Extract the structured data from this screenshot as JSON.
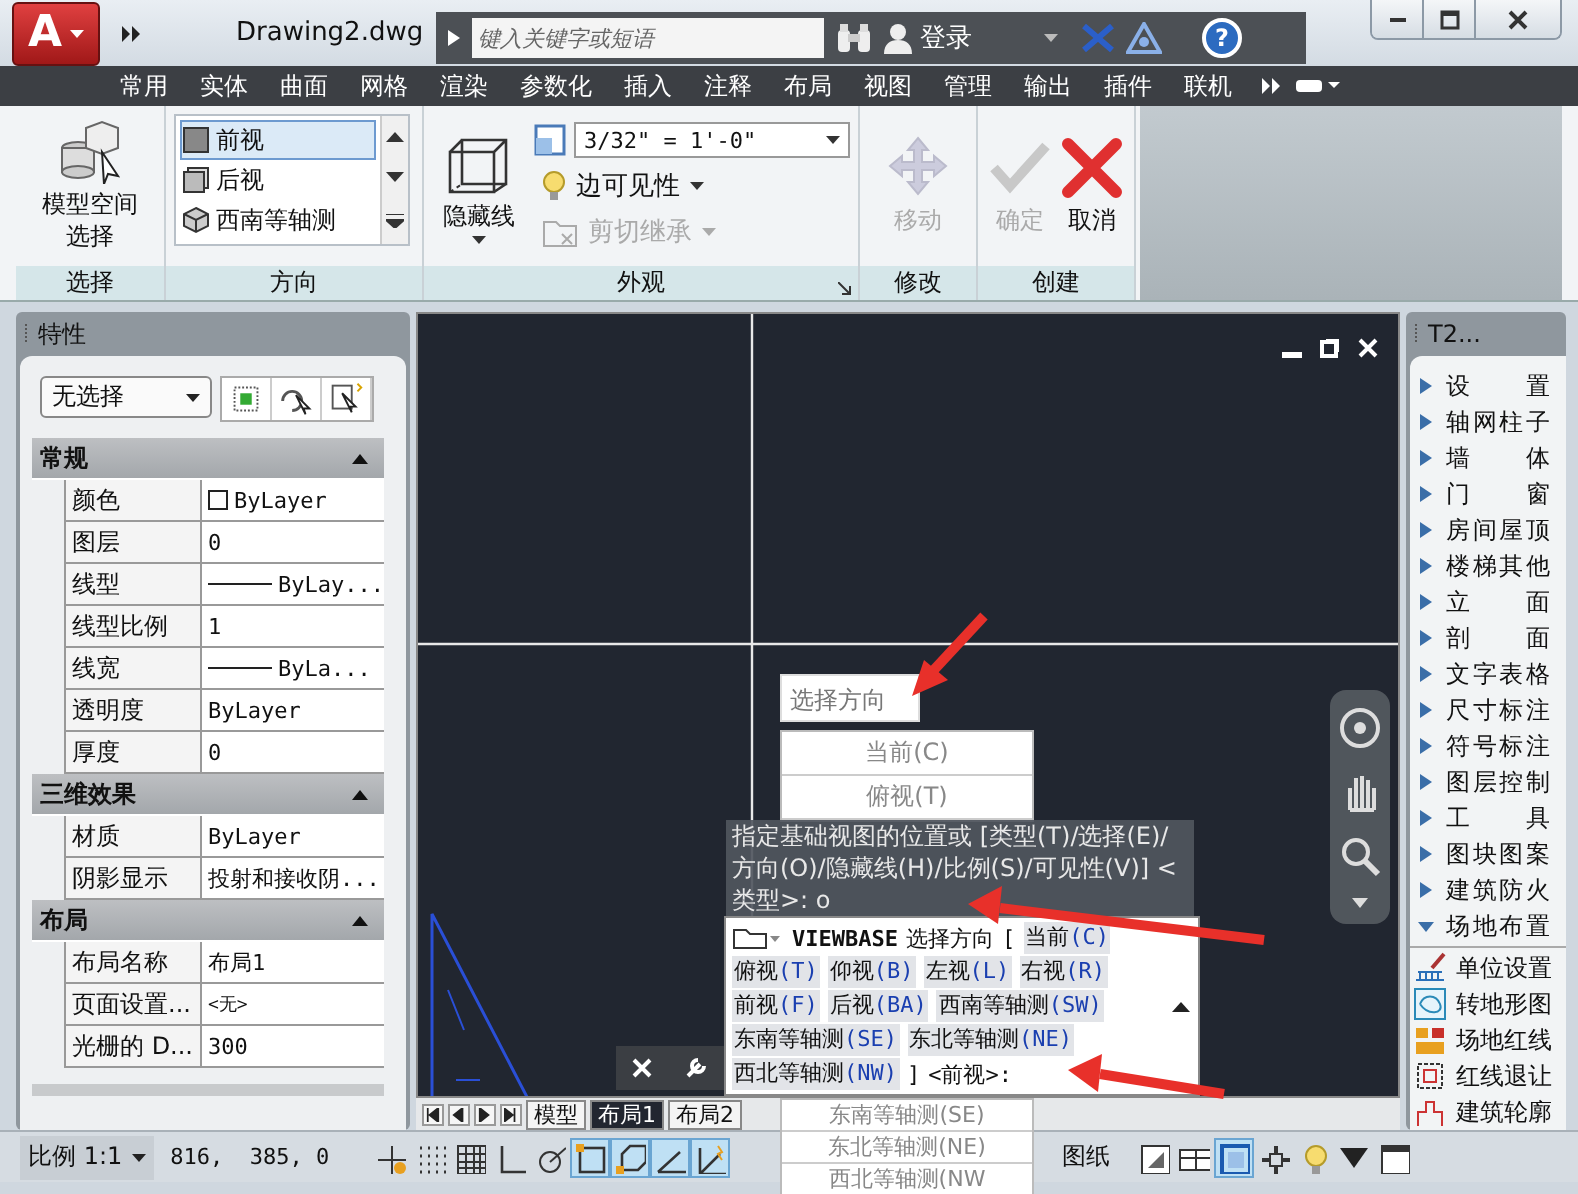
{
  "app": {
    "logo": "A",
    "title": "Drawing2.dwg",
    "search_placeholder": "键入关键字或短语",
    "login": "登录",
    "help": "?"
  },
  "ribbon_tabs": [
    "常用",
    "实体",
    "曲面",
    "网格",
    "渲染",
    "参数化",
    "插入",
    "注释",
    "布局",
    "视图",
    "管理",
    "输出",
    "插件",
    "联机"
  ],
  "ribbon_panels": [
    {
      "kind": "buttons",
      "title": "选择",
      "buttons": [
        {
          "kind": "model-space",
          "label": "模型空间选择",
          "disabled": false
        }
      ]
    },
    {
      "kind": "orientation",
      "title": "方向",
      "items": [
        {
          "label": "前视",
          "selected": true
        },
        {
          "label": "后视",
          "selected": false
        },
        {
          "label": "西南等轴测",
          "selected": false
        }
      ]
    },
    {
      "kind": "appearance",
      "title": "外观",
      "button": "隐藏线",
      "scale": "3/32\" = 1'-0\"",
      "edge_visibility": "边可见性",
      "cut_inheritance": {
        "label": "剪切继承",
        "disabled": true
      }
    },
    {
      "kind": "buttons",
      "title": "修改",
      "buttons": [
        {
          "kind": "move",
          "label": "移动",
          "disabled": true
        }
      ]
    },
    {
      "kind": "buttons",
      "title": "创建",
      "buttons": [
        {
          "kind": "confirm",
          "label": "确定",
          "disabled": true
        },
        {
          "kind": "cancel",
          "label": "取消",
          "disabled": false
        }
      ]
    }
  ],
  "properties": {
    "title": "特性",
    "selection": "无选择",
    "sections": [
      {
        "title": "常规",
        "expanded": true,
        "rows": [
          {
            "name": "颜色",
            "value": "ByLayer",
            "kind": "swatch"
          },
          {
            "name": "图层",
            "value": "0",
            "kind": "text"
          },
          {
            "name": "线型",
            "value": "ByLay...",
            "kind": "line"
          },
          {
            "name": "线型比例",
            "value": "1",
            "kind": "text"
          },
          {
            "name": "线宽",
            "value": "ByLa...",
            "kind": "line"
          },
          {
            "name": "透明度",
            "value": "ByLayer",
            "kind": "text"
          },
          {
            "name": "厚度",
            "value": "0",
            "kind": "text"
          }
        ]
      },
      {
        "title": "三维效果",
        "expanded": true,
        "rows": [
          {
            "name": "材质",
            "value": "ByLayer",
            "kind": "text"
          },
          {
            "name": "阴影显示",
            "value": "投射和接收阴...",
            "kind": "text"
          }
        ]
      },
      {
        "title": "布局",
        "expanded": true,
        "rows": [
          {
            "name": "布局名称",
            "value": "布局1",
            "kind": "text"
          },
          {
            "name": "页面设置...",
            "value": "<无>",
            "kind": "small"
          },
          {
            "name": "光栅的 D...",
            "value": "300",
            "kind": "text"
          }
        ]
      }
    ]
  },
  "layout_tabs": [
    {
      "label": "模型",
      "selected": false
    },
    {
      "label": "布局1",
      "selected": true
    },
    {
      "label": "布局2",
      "selected": false
    }
  ],
  "direction_prompt": {
    "label": "选择方向",
    "items_above": [
      "当前(C)",
      "俯视(T)"
    ],
    "items_below": [
      "东南等轴测(SE)",
      "东北等轴测(NE)",
      "西北等轴测(NW"
    ]
  },
  "command_history": "指定基础视图的位置或 [类型(T)/选择(E)/方向(O)/隐藏线(H)/比例(S)/可见性(V)] <类型>: o",
  "command_line": {
    "command": "VIEWBASE",
    "prompt": "选择方向",
    "open": "[",
    "options": [
      {
        "label": "当前",
        "key": "(C)"
      },
      {
        "label": "俯视",
        "key": "(T)"
      },
      {
        "label": "仰视",
        "key": "(B)"
      },
      {
        "label": "左视",
        "key": "(L)"
      },
      {
        "label": "右视",
        "key": "(R)"
      },
      {
        "label": "前视",
        "key": "(F)"
      },
      {
        "label": "后视",
        "key": "(BA)"
      },
      {
        "label": "西南等轴测",
        "key": "(SW)"
      },
      {
        "label": "东南等轴测",
        "key": "(SE)"
      },
      {
        "label": "东北等轴测",
        "key": "(NE)"
      },
      {
        "label": "西北等轴测",
        "key": "(NW)"
      }
    ],
    "close": "]",
    "default": "<前视>:"
  },
  "palette": {
    "title": "T2...",
    "items": [
      {
        "label": "设置",
        "expanded": false
      },
      {
        "label": "轴网柱子",
        "expanded": false
      },
      {
        "label": "墙体",
        "expanded": false
      },
      {
        "label": "门窗",
        "expanded": false
      },
      {
        "label": "房间屋顶",
        "expanded": false
      },
      {
        "label": "楼梯其他",
        "expanded": false
      },
      {
        "label": "立面",
        "expanded": false
      },
      {
        "label": "剖面",
        "expanded": false
      },
      {
        "label": "文字表格",
        "expanded": false
      },
      {
        "label": "尺寸标注",
        "expanded": false
      },
      {
        "label": "符号标注",
        "expanded": false
      },
      {
        "label": "图层控制",
        "expanded": false
      },
      {
        "label": "工具",
        "expanded": false
      },
      {
        "label": "图块图案",
        "expanded": false
      },
      {
        "label": "建筑防火",
        "expanded": false
      },
      {
        "label": "场地布置",
        "expanded": true,
        "children": [
          {
            "label": "单位设置",
            "kind": "unit"
          },
          {
            "label": "转地形图",
            "kind": "terrain"
          },
          {
            "label": "场地红线",
            "kind": "redline"
          },
          {
            "label": "红线退让",
            "kind": "setback"
          },
          {
            "label": "建筑轮廓",
            "kind": "outline"
          }
        ]
      }
    ]
  },
  "status_bar": {
    "scale": "比例 1:1",
    "coordinates": "816,  385, 0",
    "toggles": [
      {
        "kind": "infer",
        "on": false
      },
      {
        "kind": "snap",
        "on": false
      },
      {
        "kind": "grid",
        "on": false
      },
      {
        "kind": "ortho",
        "on": false
      },
      {
        "kind": "polar",
        "on": false
      },
      {
        "kind": "osnap",
        "on": true
      },
      {
        "kind": "osnap3d",
        "on": true
      },
      {
        "kind": "otrack",
        "on": true
      },
      {
        "kind": "ducs",
        "on": true
      }
    ],
    "space": "图纸",
    "right_toggles": [
      {
        "kind": "layout",
        "on": false
      },
      {
        "kind": "pages",
        "on": false
      },
      {
        "kind": "maximize",
        "on": true
      },
      {
        "kind": "sync",
        "on": false
      },
      {
        "kind": "bulb",
        "on": false
      },
      {
        "kind": "caret",
        "on": false
      },
      {
        "kind": "window",
        "on": false
      }
    ]
  }
}
